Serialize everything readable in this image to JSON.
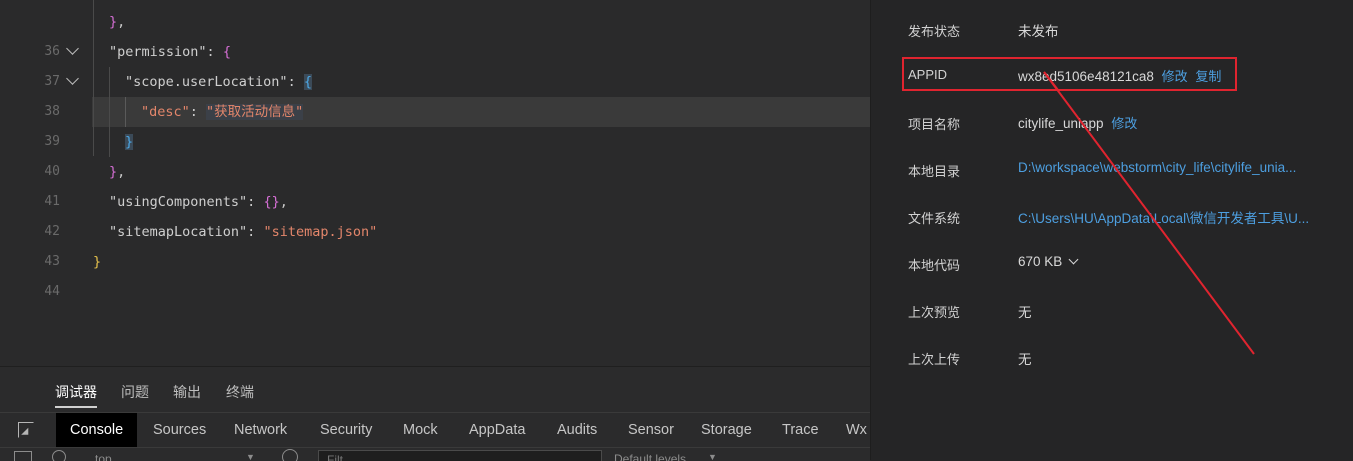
{
  "editor": {
    "lines": [
      {
        "num": "36"
      },
      {
        "num": "37",
        "key": "\"permission\""
      },
      {
        "num": "38",
        "key": "\"scope.userLocation\""
      },
      {
        "num": "39",
        "key": "\"desc\"",
        "value": "\"获取活动信息\""
      },
      {
        "num": "40"
      },
      {
        "num": "41"
      },
      {
        "num": "42",
        "key": "\"usingComponents\""
      },
      {
        "num": "43",
        "key": "\"sitemapLocation\"",
        "value": "\"sitemap.json\""
      },
      {
        "num": "44"
      }
    ]
  },
  "devtools": {
    "top_tabs": [
      "调试器",
      "问题",
      "输出",
      "终端"
    ],
    "panel_tabs": [
      "Console",
      "Sources",
      "Network",
      "Security",
      "Mock",
      "AppData",
      "Audits",
      "Sensor",
      "Storage",
      "Trace",
      "Wx"
    ],
    "filter": {
      "context": "top",
      "placeholder": "Filt",
      "levels": "Default levels"
    }
  },
  "info": {
    "rows": [
      {
        "label": "发布状态",
        "value": "未发布"
      },
      {
        "label": "APPID",
        "value": "wx8ed5106e48121ca8",
        "actions": [
          "修改",
          "复制"
        ]
      },
      {
        "label": "项目名称",
        "value": "citylife_uniapp",
        "actions": [
          "修改"
        ]
      },
      {
        "label": "本地目录",
        "value": "D:\\workspace\\webstorm\\city_life\\citylife_unia..."
      },
      {
        "label": "文件系统",
        "value": "C:\\Users\\HU\\AppData\\Local\\微信开发者工具\\U..."
      },
      {
        "label": "本地代码",
        "value": "670 KB"
      },
      {
        "label": "上次预览",
        "value": "无"
      },
      {
        "label": "上次上传",
        "value": "无"
      }
    ]
  },
  "colors": {
    "accent_link": "#4d9fe0",
    "annotation_red": "#e0242f",
    "string": "#e3866b"
  }
}
